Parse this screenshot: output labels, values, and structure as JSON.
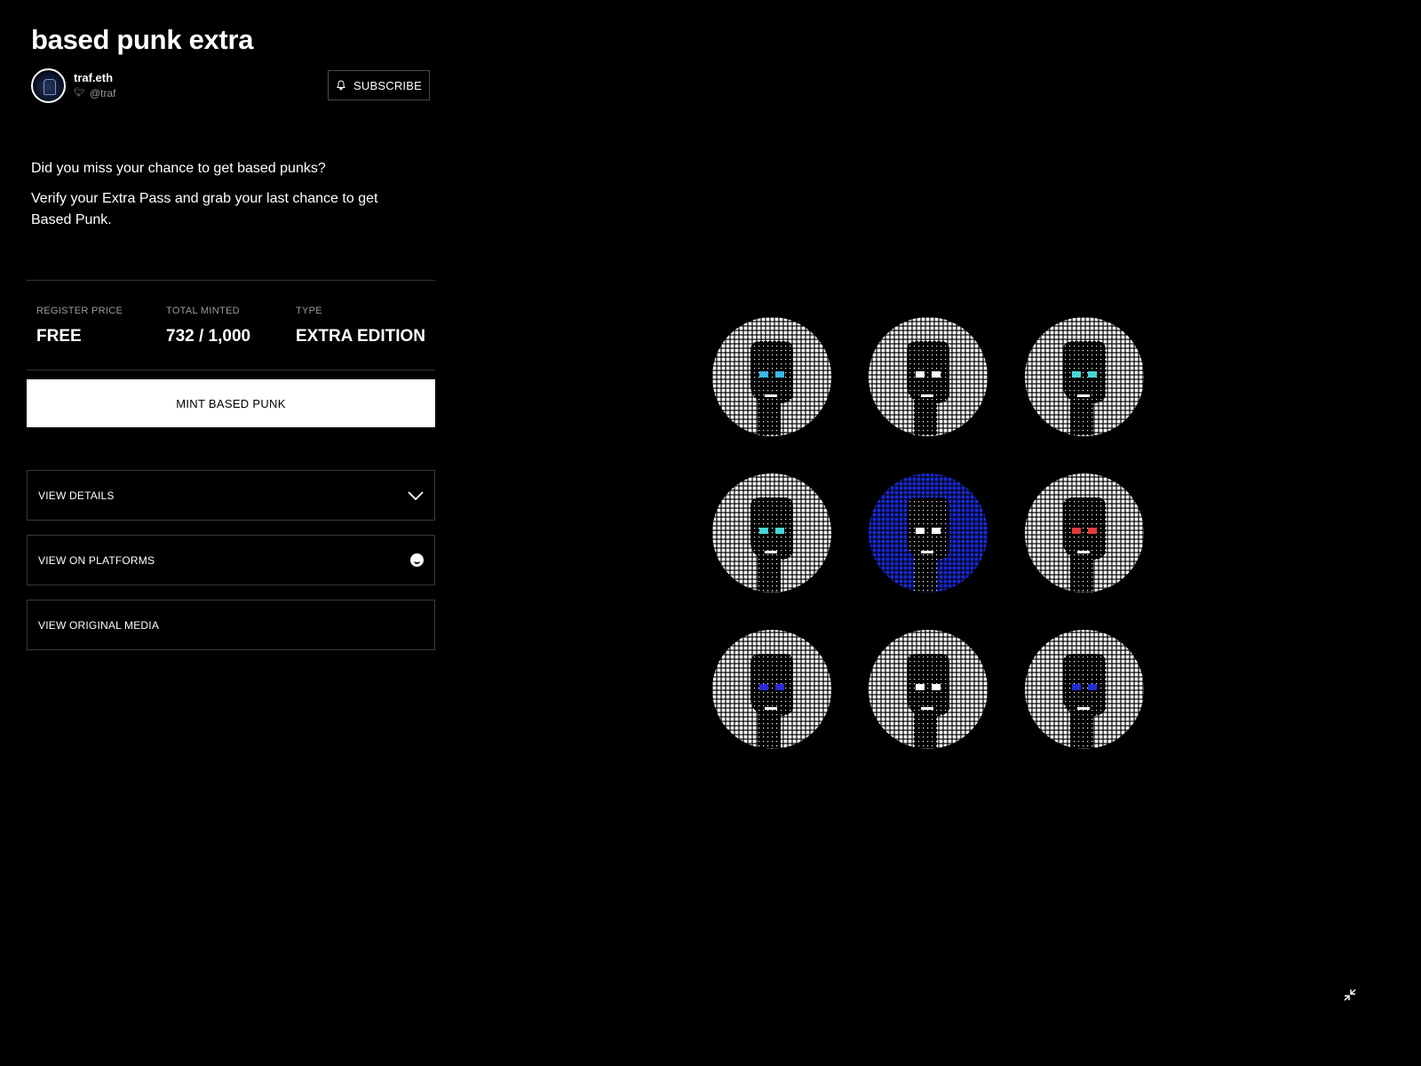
{
  "collection": {
    "title": "based punk extra"
  },
  "artist": {
    "name": "traf.eth",
    "handle": "@traf"
  },
  "subscribe": {
    "label": "SUBSCRIBE",
    "icon": "bell-icon"
  },
  "description": [
    "Did you miss your chance to get based punks?",
    "Verify your Extra Pass and grab your last chance to get Based Punk."
  ],
  "stats": [
    {
      "label": "REGISTER PRICE",
      "value": "FREE"
    },
    {
      "label": "TOTAL MINTED",
      "value": "732 / 1,000"
    },
    {
      "label": "TYPE",
      "value": "EXTRA EDITION"
    }
  ],
  "mint": {
    "label": "MINT BASED PUNK"
  },
  "accordion": [
    {
      "label": "VIEW DETAILS",
      "icon": "chevron-down-icon"
    },
    {
      "label": "VIEW ON PLATFORMS",
      "icon": "opensea-icon"
    },
    {
      "label": "VIEW ORIGINAL MEDIA",
      "icon": ""
    }
  ],
  "gallery": {
    "punks": [
      {
        "bg": "#ffffff",
        "accent": "#39b7e6"
      },
      {
        "bg": "#ffffff",
        "accent": "#ffffff"
      },
      {
        "bg": "#ffffff",
        "accent": "#46d6d9"
      },
      {
        "bg": "#ffffff",
        "accent": "#46d6d9"
      },
      {
        "bg": "#1a2ad6",
        "accent": "#ffffff"
      },
      {
        "bg": "#ffffff",
        "accent": "#e23a3a"
      },
      {
        "bg": "#ffffff",
        "accent": "#2d2bd6"
      },
      {
        "bg": "#ffffff",
        "accent": "#ffffff"
      },
      {
        "bg": "#ffffff",
        "accent": "#1f2fd0"
      }
    ]
  },
  "colors": {
    "background": "#000000",
    "text": "#ffffff",
    "muted": "#9a9a9a",
    "border": "#3a3a3a"
  }
}
